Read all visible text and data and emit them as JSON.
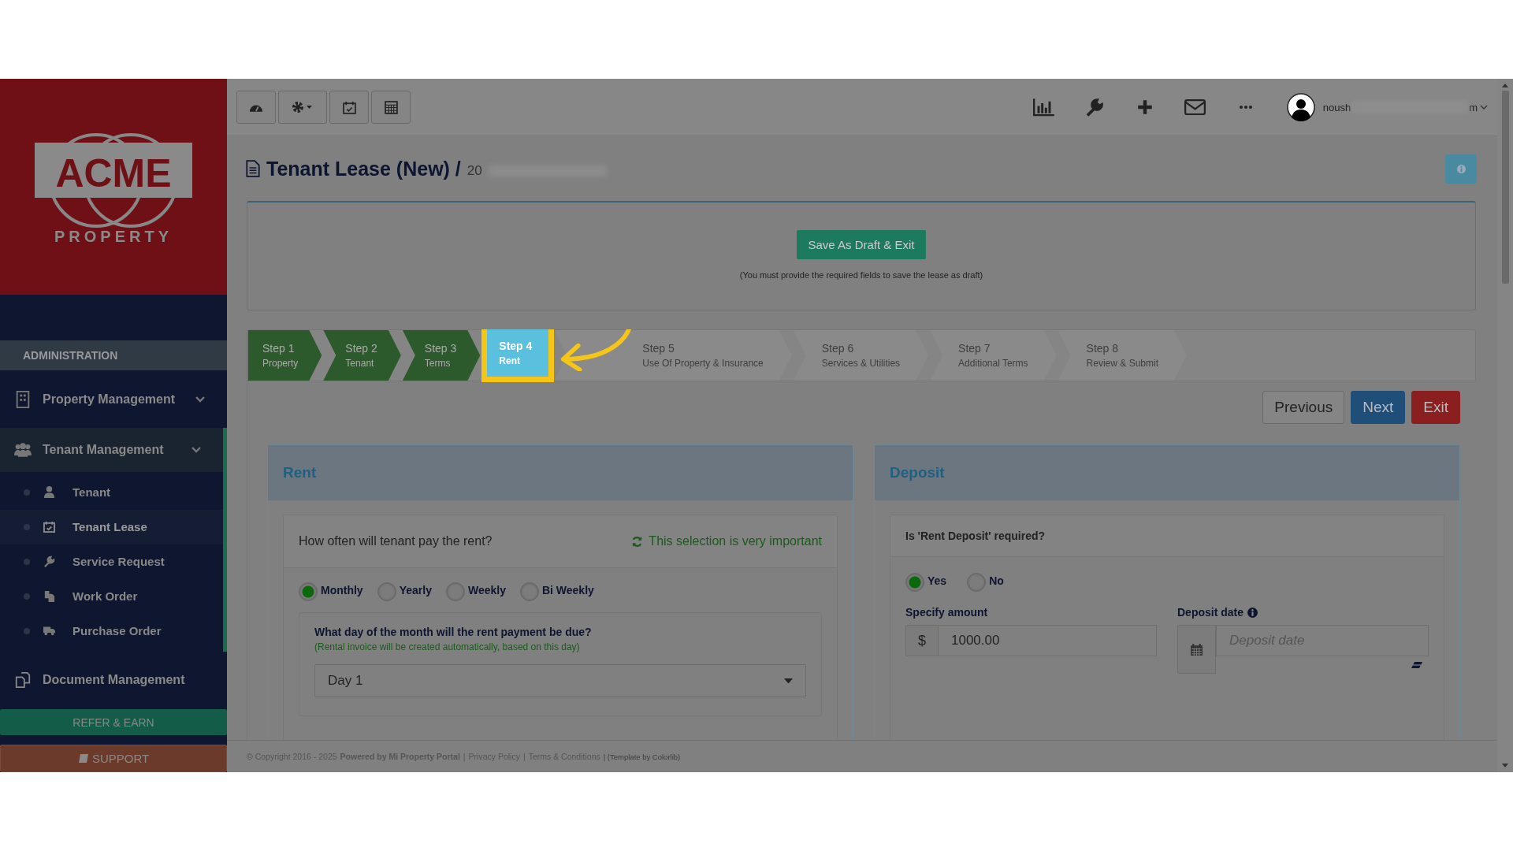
{
  "sidebar": {
    "logo": {
      "title": "ACME",
      "subtitle": "PROPERTY"
    },
    "section": "ADMINISTRATION",
    "items": [
      {
        "label": "Property Management",
        "expanded": false
      },
      {
        "label": "Tenant Management",
        "expanded": true,
        "children": [
          {
            "label": "Tenant",
            "selected": false
          },
          {
            "label": "Tenant Lease",
            "selected": true
          },
          {
            "label": "Service Request",
            "selected": false
          },
          {
            "label": "Work Order",
            "selected": false
          },
          {
            "label": "Purchase Order",
            "selected": false
          }
        ]
      },
      {
        "label": "Document Management",
        "expanded": false
      }
    ],
    "refer_button": "REFER & EARN",
    "support_button": "SUPPORT"
  },
  "topbar": {
    "user_name_start": "noush",
    "user_name_end": "m"
  },
  "header": {
    "title": "Tenant Lease (New) /",
    "subtitle": "20"
  },
  "draft": {
    "button": "Save As Draft & Exit",
    "note": "(You must provide the required fields to save the lease as draft)"
  },
  "steps": [
    {
      "number": "Step 1",
      "label": "Property",
      "completed": true,
      "selected": false
    },
    {
      "number": "Step 2",
      "label": "Tenant",
      "completed": true,
      "selected": false
    },
    {
      "number": "Step 3",
      "label": "Terms",
      "completed": true,
      "selected": false
    },
    {
      "number": "Step 4",
      "label": "Rent",
      "completed": false,
      "selected": true
    },
    {
      "number": "Step 5",
      "label": "Use Of Property & Insurance",
      "completed": false,
      "selected": false
    },
    {
      "number": "Step 6",
      "label": "Services & Utilities",
      "completed": false,
      "selected": false
    },
    {
      "number": "Step 7",
      "label": "Additional Terms",
      "completed": false,
      "selected": false
    },
    {
      "number": "Step 8",
      "label": "Review & Submit",
      "completed": false,
      "selected": false
    }
  ],
  "nav_buttons": {
    "previous": "Previous",
    "next": "Next",
    "exit": "Exit"
  },
  "rent": {
    "title": "Rent",
    "question": "How often will tenant pay the rent?",
    "hint": "This selection is very important",
    "options": [
      {
        "label": "Monthly",
        "selected": true
      },
      {
        "label": "Yearly",
        "selected": false
      },
      {
        "label": "Weekly",
        "selected": false
      },
      {
        "label": "Bi Weekly",
        "selected": false
      }
    ],
    "due_question": "What day of the month will the rent payment be due?",
    "due_hint": "(Rental invoice will be created automatically, based on this day)",
    "due_value": "Day 1"
  },
  "deposit": {
    "title": "Deposit",
    "question": "Is 'Rent Deposit' required?",
    "options": [
      {
        "label": "Yes",
        "selected": true
      },
      {
        "label": "No",
        "selected": false
      }
    ],
    "amount_label": "Specify amount",
    "currency": "$",
    "amount": "1000.00",
    "date_label": "Deposit date",
    "date_placeholder": "Deposit date"
  },
  "footer": [
    {
      "kind": "text",
      "text": "© Copyright 2016 - 2025"
    },
    {
      "kind": "bold",
      "text": "Powered by Mi Property Portal"
    },
    {
      "kind": "sep",
      "text": "|"
    },
    {
      "kind": "link",
      "text": "Privacy Policy"
    },
    {
      "kind": "sep",
      "text": "|"
    },
    {
      "kind": "link",
      "text": "Terms & Conditions"
    },
    {
      "kind": "small",
      "text": "| (Template by Colorlib)"
    }
  ]
}
